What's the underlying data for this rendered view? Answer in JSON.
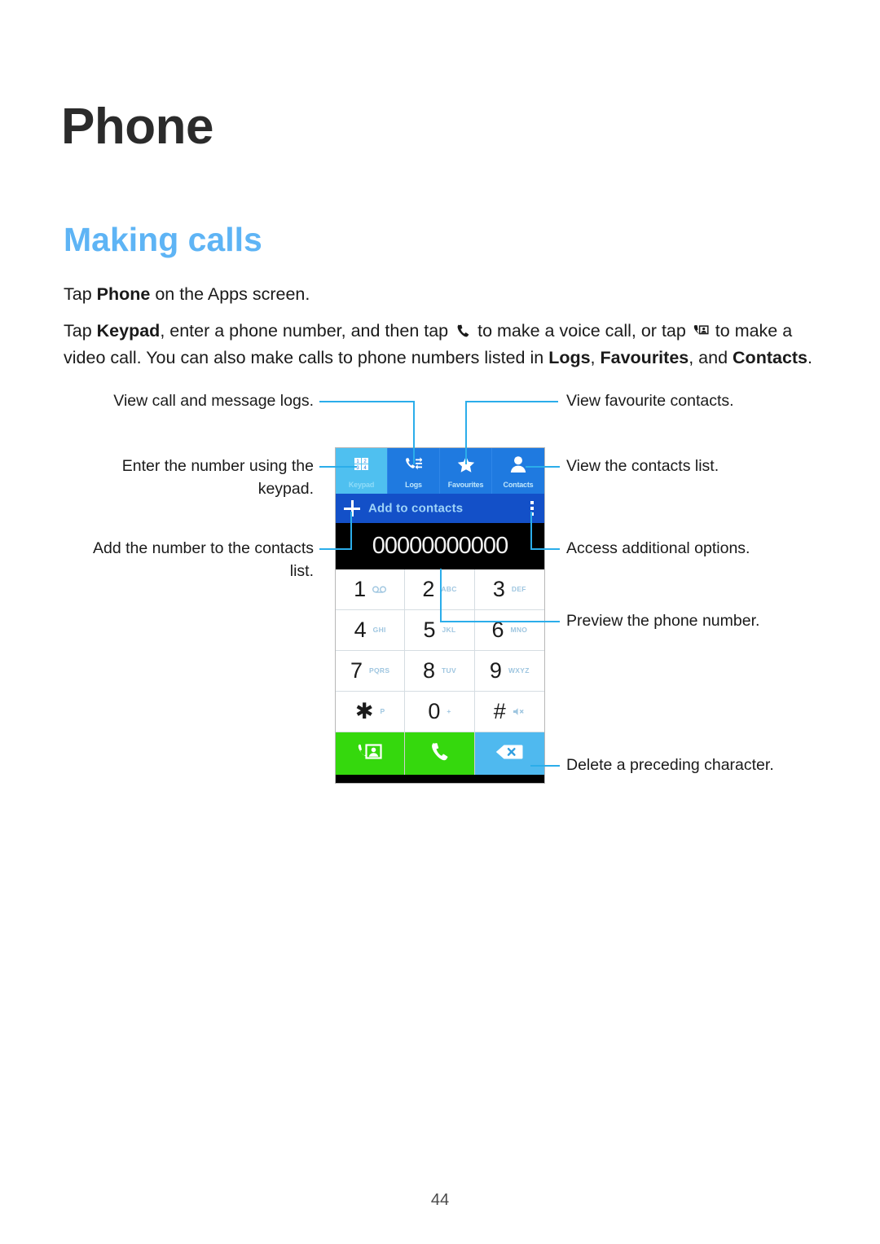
{
  "page": {
    "title": "Phone",
    "section_title": "Making calls",
    "number": "44"
  },
  "body": {
    "paragraph_1": {
      "pre": "Tap ",
      "bold_1": "Phone",
      "post": " on the Apps screen."
    },
    "paragraph_2": {
      "seg_1": "Tap ",
      "bold_1": "Keypad",
      "seg_2": ", enter a phone number, and then tap ",
      "icon_1": "voice-call-icon",
      "seg_3": " to make a voice call, or tap ",
      "icon_2": "video-call-icon",
      "seg_4": " to make a video call. You can also make calls to phone numbers listed in ",
      "bold_2": "Logs",
      "seg_5": ", ",
      "bold_3": "Favourites",
      "seg_6": ", and ",
      "bold_4": "Contacts",
      "seg_7": "."
    }
  },
  "phone_ui": {
    "tabs": [
      {
        "label": "Keypad",
        "icon": "keypad-icon",
        "selected": true
      },
      {
        "label": "Logs",
        "icon": "call-logs-icon",
        "selected": false
      },
      {
        "label": "Favourites",
        "icon": "star-icon",
        "selected": false
      },
      {
        "label": "Contacts",
        "icon": "person-icon",
        "selected": false
      }
    ],
    "add_to_contacts_label": "Add to contacts",
    "more_options_icon": "overflow-menu-icon",
    "add_icon": "plus-icon",
    "number_display": "00000000000",
    "keypad": [
      [
        {
          "digit": "1",
          "sub": "",
          "sub_icon": "voicemail-icon"
        },
        {
          "digit": "2",
          "sub": "ABC",
          "sub_icon": ""
        },
        {
          "digit": "3",
          "sub": "DEF",
          "sub_icon": ""
        }
      ],
      [
        {
          "digit": "4",
          "sub": "GHI",
          "sub_icon": ""
        },
        {
          "digit": "5",
          "sub": "JKL",
          "sub_icon": ""
        },
        {
          "digit": "6",
          "sub": "MNO",
          "sub_icon": ""
        }
      ],
      [
        {
          "digit": "7",
          "sub": "PQRS",
          "sub_icon": ""
        },
        {
          "digit": "8",
          "sub": "TUV",
          "sub_icon": ""
        },
        {
          "digit": "9",
          "sub": "WXYZ",
          "sub_icon": ""
        }
      ],
      [
        {
          "digit": "✱",
          "sub": "P",
          "sub_icon": ""
        },
        {
          "digit": "0",
          "sub": "+",
          "sub_icon": ""
        },
        {
          "digit": "#",
          "sub": "",
          "sub_icon": "mute-icon"
        }
      ]
    ],
    "actions": [
      {
        "name": "video-call-button",
        "icon": "video-call-icon",
        "color": "#35d80d"
      },
      {
        "name": "voice-call-button",
        "icon": "voice-call-icon",
        "color": "#35d80d"
      },
      {
        "name": "backspace-button",
        "icon": "backspace-icon",
        "color": "#4fb9ef"
      }
    ]
  },
  "callouts": {
    "view_logs": "View call and message logs.",
    "enter_number": "Enter the number using the keypad.",
    "add_to_contacts": "Add the number to the contacts list.",
    "view_favourites": "View favourite contacts.",
    "view_contacts": "View the contacts list.",
    "additional_options": "Access additional options.",
    "preview_number": "Preview the phone number.",
    "delete_character": "Delete a preceding character."
  },
  "colors": {
    "accent_blue": "#5EB4F5",
    "leader_blue": "#2badea",
    "tab_selected": "#4fc0f0",
    "tab_normal": "#1f7ae0",
    "add_bar": "#1350c8",
    "action_green": "#35d80d",
    "action_blue": "#4fb9ef"
  }
}
